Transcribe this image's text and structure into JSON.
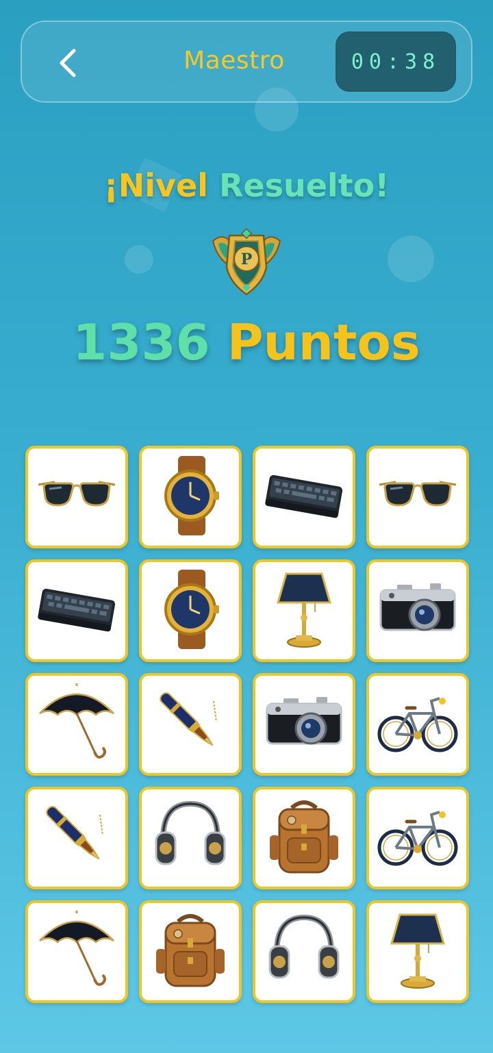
{
  "header": {
    "back_icon": "chevron-left-icon",
    "title": "Maestro",
    "timer": "00:38"
  },
  "result": {
    "title_part1": "¡Nivel",
    "title_part2": "Resuelto!",
    "badge_letter": "P",
    "badge_icon": "rank-shield-icon",
    "points_value": "1336",
    "points_label": "Puntos"
  },
  "colors": {
    "accent_yellow": "#f7c51d",
    "accent_mint": "#5fe0a8",
    "timer_bg": "#22606f",
    "card_border": "#f0c623"
  },
  "board": {
    "rows": 5,
    "columns": 4,
    "cards": [
      {
        "item": "sunglasses"
      },
      {
        "item": "watch"
      },
      {
        "item": "keyboard"
      },
      {
        "item": "sunglasses"
      },
      {
        "item": "keyboard"
      },
      {
        "item": "watch"
      },
      {
        "item": "lamp"
      },
      {
        "item": "camera"
      },
      {
        "item": "umbrella"
      },
      {
        "item": "pen"
      },
      {
        "item": "camera"
      },
      {
        "item": "bicycle"
      },
      {
        "item": "pen"
      },
      {
        "item": "headphones"
      },
      {
        "item": "backpack"
      },
      {
        "item": "bicycle"
      },
      {
        "item": "umbrella"
      },
      {
        "item": "backpack"
      },
      {
        "item": "headphones"
      },
      {
        "item": "lamp"
      }
    ]
  }
}
